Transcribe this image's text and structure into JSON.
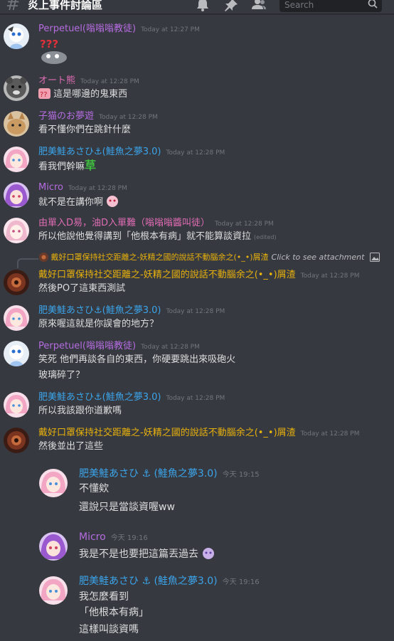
{
  "header": {
    "hash": "#",
    "channel": "炎上事件討論區",
    "search_placeholder": "Search"
  },
  "colors": {
    "background": "#36393f",
    "blue_name": "#3ba5ec",
    "purple_name": "#b56ce0",
    "gold_name": "#e8b10c",
    "pink_name": "#e06cb5"
  },
  "messages": [
    {
      "author": "Perpetuel(嗡嗡嗡教徒)",
      "time": "Today at 12:27 PM",
      "lines": []
    },
    {
      "author": "オート熊",
      "time": "Today at 12:28 PM",
      "lines": [
        "這是哪邊的鬼東西"
      ]
    },
    {
      "author": "子猫のお夢遊",
      "time": "Today at 12:28 PM",
      "lines": [
        "看不懂你們在跳針什麼"
      ]
    },
    {
      "author": "肥美鮭あさひ⚓(鮭魚之夢3.0)",
      "time": "Today at 12:28 PM",
      "lines": [
        "看我們幹嘛"
      ],
      "inline_text": "草"
    },
    {
      "author": "Micro",
      "time": "Today at 12:28 PM",
      "lines": [
        "就不是在講你啊"
      ]
    },
    {
      "author": "由單入D易，油D入單難（嗡嗡嗡醬叫徒）",
      "time": "Today at 12:28 PM",
      "lines": [
        "所以他說他覺得講到「他根本有病」就不能算談資拉"
      ],
      "edited": "(edited)"
    },
    {
      "author": "戴好口罩保持社交距離之-妖精之國的說話不動腦余之(•_•)屑渣",
      "time": "Today at 12:28 PM",
      "lines": [
        "然後PO了這東西測試"
      ],
      "reply": {
        "author": "戴好口罩保持社交距離之-妖精之國的說話不動腦余之(•_•)屑渣",
        "text": "Click to see attachment"
      }
    },
    {
      "author": "肥美鮭あさひ⚓(鮭魚之夢3.0)",
      "time": "Today at 12:28 PM",
      "lines": [
        "原來喔這就是你誤會的地方？"
      ]
    },
    {
      "author": "Perpetuel(嗡嗡嗡教徒)",
      "time": "Today at 12:28 PM",
      "lines": [
        "笑死 他們再談各自的東西，你硬要跳出來吸砲火",
        "玻璃碎了？"
      ]
    },
    {
      "author": "肥美鮭あさひ⚓(鮭魚之夢3.0)",
      "time": "Today at 12:28 PM",
      "lines": [
        "所以我該跟你道歉嗎"
      ]
    },
    {
      "author": "戴好口罩保持社交距離之-妖精之國的說話不動腦余之(•_•)屑渣",
      "time": "Today at 12:28 PM",
      "lines": [
        "然後並出了這些"
      ]
    },
    {
      "author": "肥美鮭あさひ ⚓ (鮭魚之夢3.0)",
      "time": "今天 19:15",
      "lines": [
        "不懂欸",
        "還說只是當談資喔ww"
      ]
    },
    {
      "author": "Micro",
      "time": "今天 19:16",
      "lines": [
        "我是不是也要把這篇丟過去"
      ]
    },
    {
      "author": "肥美鮭あさひ ⚓ (鮭魚之夢3.0)",
      "time": "今天 19:16",
      "lines": [
        "我怎麼看到",
        "「他根本有病」",
        "這樣叫談資嗎"
      ]
    }
  ]
}
